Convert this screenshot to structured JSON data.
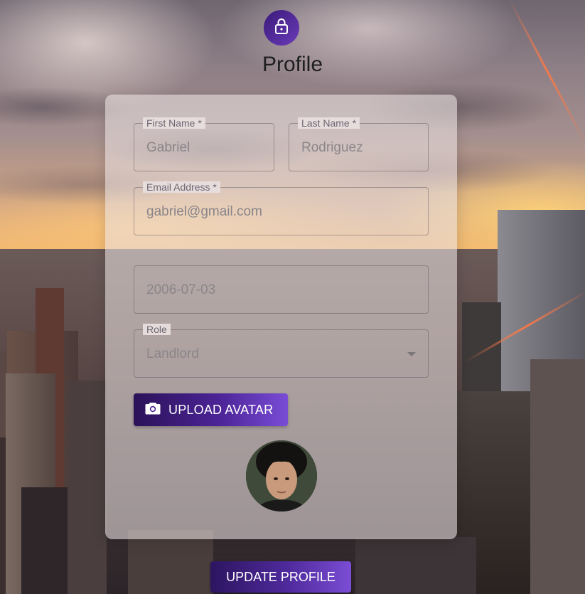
{
  "header": {
    "icon": "lock-icon",
    "title": "Profile"
  },
  "form": {
    "first_name": {
      "label": "First Name *",
      "value": "Gabriel"
    },
    "last_name": {
      "label": "Last Name *",
      "value": "Rodriguez"
    },
    "email": {
      "label": "Email Address *",
      "value": "gabriel@gmail.com"
    },
    "birth_date": {
      "value": "2006-07-03"
    },
    "role": {
      "label": "Role",
      "value": "Landlord"
    }
  },
  "upload": {
    "label": "UPLOAD AVATAR",
    "icon": "camera-icon"
  },
  "submit": {
    "label": "UPDATE PROFILE"
  },
  "colors": {
    "accent_dark": "#2b1258",
    "accent_light": "#7a4cd6"
  }
}
